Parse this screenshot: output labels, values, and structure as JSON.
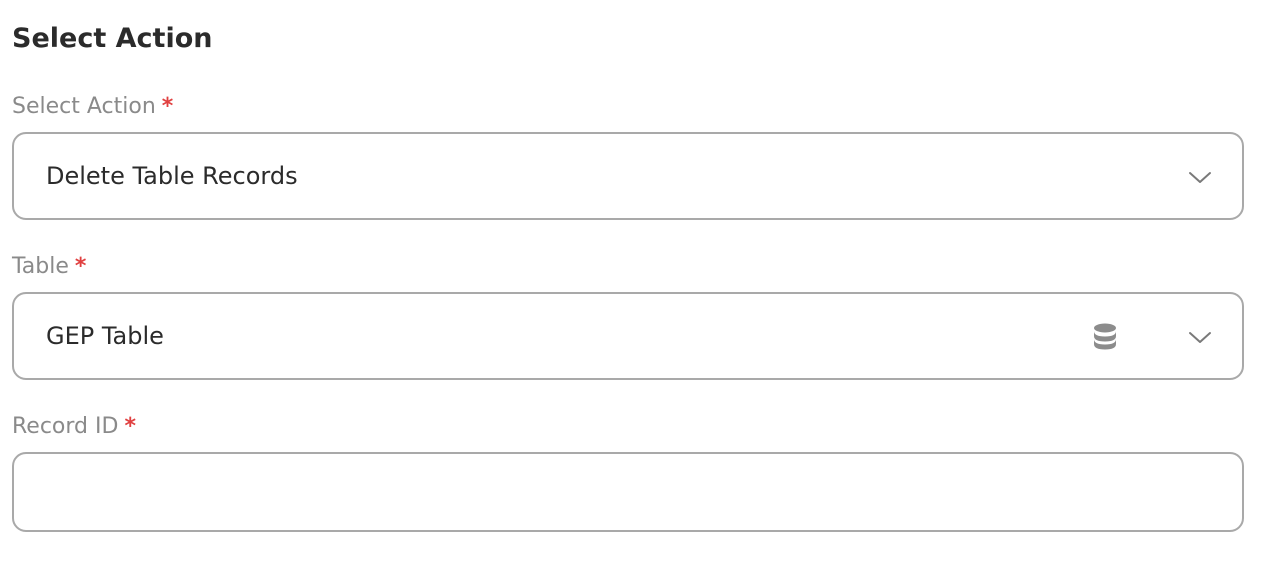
{
  "header": {
    "title": "Select Action"
  },
  "fields": {
    "action": {
      "label": "Select Action",
      "required_mark": "*",
      "value": "Delete Table Records",
      "icon": "chevron-down-icon"
    },
    "table": {
      "label": "Table",
      "required_mark": "*",
      "value": "GEP Table",
      "icons": [
        "database-icon",
        "chevron-down-icon"
      ]
    },
    "record_id": {
      "label": "Record ID",
      "required_mark": "*",
      "value": "",
      "placeholder": ""
    }
  },
  "colors": {
    "required": "#e04040",
    "label": "#8a8a8a",
    "border": "#a9a9a9",
    "text": "#2b2b2b"
  }
}
